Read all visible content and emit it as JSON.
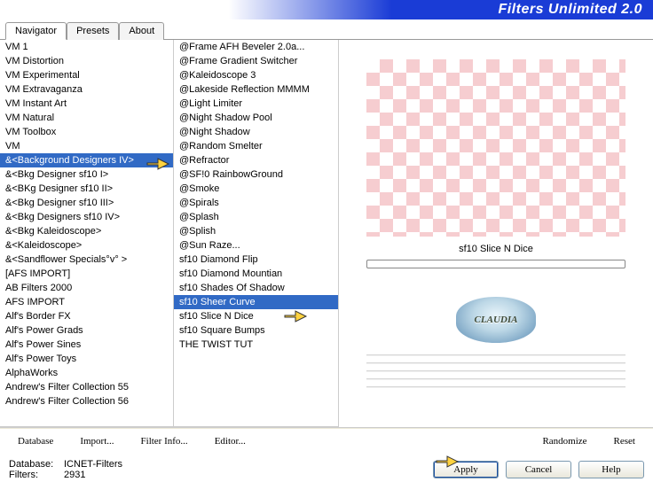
{
  "app": {
    "title": "Filters Unlimited 2.0"
  },
  "tabs": {
    "items": [
      "Navigator",
      "Presets",
      "About"
    ],
    "active": 0
  },
  "categories": {
    "selected": 8,
    "items": [
      "VM 1",
      "VM Distortion",
      "VM Experimental",
      "VM Extravaganza",
      "VM Instant Art",
      "VM Natural",
      "VM Toolbox",
      "VM",
      "&<Background Designers IV>",
      "&<Bkg Designer sf10 I>",
      "&<BKg Designer sf10 II>",
      "&<Bkg Designer sf10 III>",
      "&<Bkg Designers sf10 IV>",
      "&<Bkg Kaleidoscope>",
      "&<Kaleidoscope>",
      "&<Sandflower Specials°v° >",
      "[AFS IMPORT]",
      "AB Filters 2000",
      "AFS IMPORT",
      "Alf's Border FX",
      "Alf's Power Grads",
      "Alf's Power Sines",
      "Alf's Power Toys",
      "AlphaWorks",
      "Andrew's Filter Collection 55",
      "Andrew's Filter Collection 56"
    ]
  },
  "filters": {
    "selected": 18,
    "items": [
      "@Frame AFH Beveler 2.0a...",
      "@Frame Gradient Switcher",
      "@Kaleidoscope 3",
      "@Lakeside Reflection MMMM",
      "@Light Limiter",
      "@Night Shadow Pool",
      "@Night Shadow",
      "@Random Smelter",
      "@Refractor",
      "@SF!0 RainbowGround",
      "@Smoke",
      "@Spirals",
      "@Splash",
      "@Splish",
      "@Sun Raze...",
      "sf10 Diamond Flip",
      "sf10 Diamond Mountian",
      "sf10 Shades Of Shadow",
      "sf10 Sheer Curve",
      "sf10 Slice N Dice",
      "sf10 Square Bumps",
      "THE TWIST TUT"
    ]
  },
  "preview": {
    "label": "sf10 Slice N Dice",
    "logo": "CLAUDIA"
  },
  "toolbar": {
    "database": "Database",
    "import": "Import...",
    "filterinfo": "Filter Info...",
    "editor": "Editor...",
    "randomize": "Randomize",
    "reset": "Reset"
  },
  "status": {
    "db_label": "Database:",
    "db_value": "ICNET-Filters",
    "filters_label": "Filters:",
    "filters_value": "2931"
  },
  "buttons": {
    "apply": "Apply",
    "cancel": "Cancel",
    "help": "Help"
  }
}
